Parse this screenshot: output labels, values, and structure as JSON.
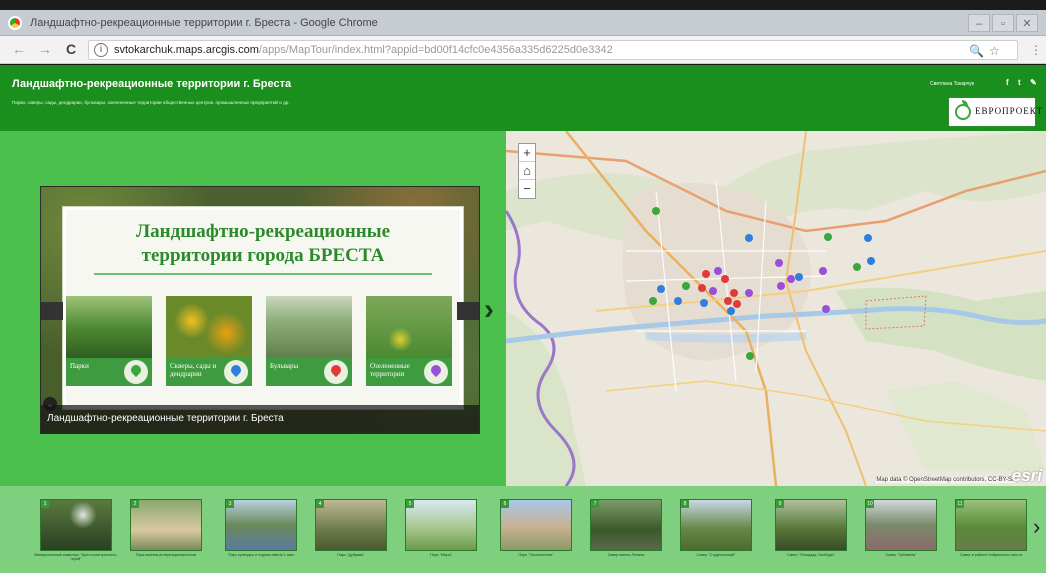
{
  "browser": {
    "window_title": "Ландшафтно-рекреационные территории г. Бреста - Google Chrome",
    "url_host": "svtokarchuk.maps.arcgis.com",
    "url_path": "/apps/MapTour/index.html?appid=bd00f14cfc0e4356a335d6225d0e3342",
    "controls": [
      "←",
      "→",
      "C"
    ],
    "right_icons": [
      "🔍",
      "☆",
      "⋮"
    ]
  },
  "header": {
    "title": "Ландшафтно-рекреационные территории г. Бреста",
    "subtitle": "Парки, скверы, сады, дендрарии, бульвары, озелененные территории общественных центров, промышленных предприятий и др.",
    "author": "Светлана Токарчук",
    "social": [
      "f",
      "t",
      "✎"
    ],
    "logo_text": "ЕВРОПРОЕКТ"
  },
  "slide": {
    "title_line1": "Ландшафтно-рекреационные",
    "title_line2": "территории города БРЕСТА",
    "caption": "Ландшафтно-рекреационные территории г. Бреста",
    "cards": [
      {
        "label": "Парки",
        "pin_color": "#3aa83a"
      },
      {
        "label": "Скверы, сады и дендрарии",
        "pin_color": "#2f7fe0"
      },
      {
        "label": "Бульвары",
        "pin_color": "#e03a3a"
      },
      {
        "label": "Озелененные территории",
        "pin_color": "#9a4fd8"
      }
    ],
    "next_label": "›"
  },
  "map": {
    "zoom_in": "+",
    "home": "⌂",
    "zoom_out": "−",
    "attribution": "Map data © OpenStreetMap contributors, CC-BY-SA",
    "esri": "esri"
  },
  "thumbnails": [
    {
      "num": "1",
      "label": "Мемориальный комплекс \"Брестская крепость-герой\""
    },
    {
      "num": "2",
      "label": "Парк воинов-интернационалистов"
    },
    {
      "num": "3",
      "label": "Парк культуры и отдыха имени 1 мая"
    },
    {
      "num": "4",
      "label": "Парк \"Дубрава\""
    },
    {
      "num": "5",
      "label": "Парк \"Мира\""
    },
    {
      "num": "6",
      "label": "Парк \"Тысячелетия\""
    },
    {
      "num": "7",
      "label": "Сквер имени Ленина"
    },
    {
      "num": "8",
      "label": "Сквер \"Студенческий\""
    },
    {
      "num": "9",
      "label": "Сквер \"Площадь Свободы\""
    },
    {
      "num": "10",
      "label": "Сквер \"Зубовнев\""
    },
    {
      "num": "11",
      "label": "Сквер в районе Кобринского моста"
    }
  ],
  "strip_next": "›",
  "colors": {
    "header_green": "#1b8f1e",
    "stage_green": "#4cc04c",
    "strip_green": "#7ed07e"
  }
}
